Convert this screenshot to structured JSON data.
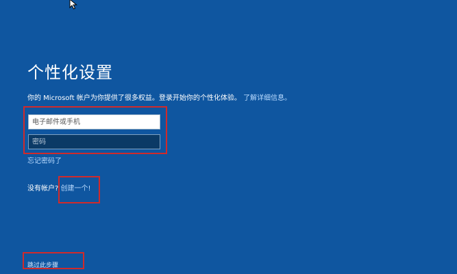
{
  "page": {
    "title": "个性化设置",
    "subtitle_text": "你的 Microsoft 帐户为你提供了很多权益。登录开始你的个性化体验。",
    "subtitle_link": "了解详细信息。"
  },
  "form": {
    "email_placeholder": "电子邮件或手机",
    "password_placeholder": "密码",
    "forgot_password": "忘记密码了",
    "no_account_text": "没有帐户?",
    "create_account": "创建一个!",
    "skip_step": "跳过此步骤"
  },
  "colors": {
    "background": "#0f56a0",
    "link": "#b9dbff",
    "annotation_red": "#d12a2a"
  },
  "icons": {
    "cursor": "mouse-cursor-icon"
  }
}
